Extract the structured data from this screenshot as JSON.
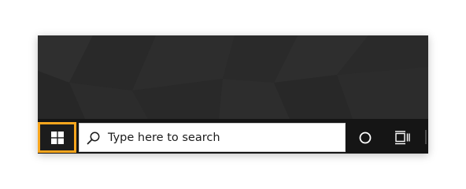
{
  "taskbar": {
    "start": {
      "icon": "windows-logo-icon",
      "highlight_color": "#f8a61e"
    },
    "search": {
      "icon": "search-icon",
      "placeholder": "Type here to search"
    },
    "cortana": {
      "icon": "circle-icon"
    },
    "task_view": {
      "icon": "task-view-icon"
    }
  }
}
